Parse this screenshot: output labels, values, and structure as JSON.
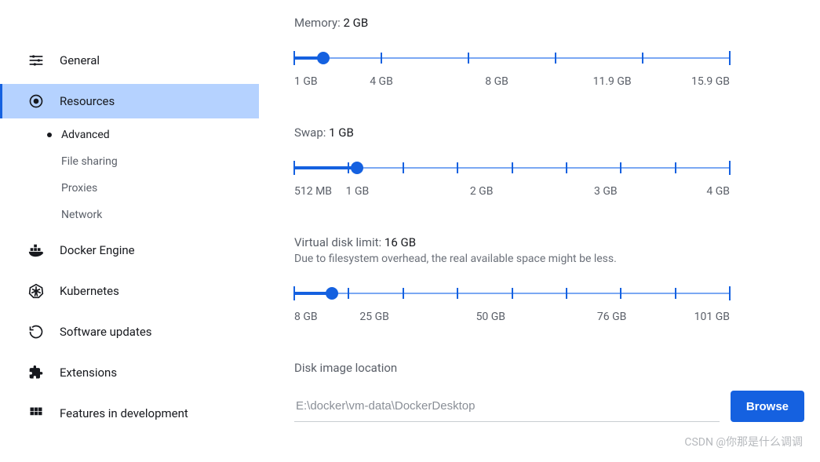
{
  "sidebar": {
    "items": [
      {
        "label": "General"
      },
      {
        "label": "Resources"
      },
      {
        "label": "Docker Engine"
      },
      {
        "label": "Kubernetes"
      },
      {
        "label": "Software updates"
      },
      {
        "label": "Extensions"
      },
      {
        "label": "Features in development"
      }
    ],
    "resources_sub": [
      {
        "label": "Advanced",
        "selected": true
      },
      {
        "label": "File sharing"
      },
      {
        "label": "Proxies"
      },
      {
        "label": "Network"
      }
    ]
  },
  "memory": {
    "label": "Memory:",
    "value": "2 GB",
    "ticks_pct": [
      0,
      20,
      40,
      60,
      80,
      100
    ],
    "thumb_pct": 6.7,
    "scale_labels": [
      "1 GB",
      "4 GB",
      "8 GB",
      "11.9 GB",
      "15.9 GB"
    ],
    "scale_pos_pct": [
      0,
      20,
      46.5,
      73,
      100
    ]
  },
  "swap": {
    "label": "Swap:",
    "value": "1 GB",
    "ticks_pct": [
      0,
      12.5,
      25,
      37.5,
      50,
      62.5,
      75,
      87.5,
      100
    ],
    "thumb_pct": 14.5,
    "scale_labels": [
      "512 MB",
      "1 GB",
      "2 GB",
      "3 GB",
      "4 GB"
    ],
    "scale_pos_pct": [
      0,
      14.5,
      43,
      71.5,
      100
    ]
  },
  "vdisk": {
    "label": "Virtual disk limit:",
    "value": "16 GB",
    "note": "Due to filesystem overhead, the real available space might be less.",
    "ticks_pct": [
      0,
      12.5,
      25,
      37.5,
      50,
      62.5,
      75,
      87.5,
      100
    ],
    "thumb_pct": 8.6,
    "scale_labels": [
      "8 GB",
      "25 GB",
      "50 GB",
      "76 GB",
      "101 GB"
    ],
    "scale_pos_pct": [
      0,
      18.4,
      45.1,
      72.9,
      100
    ]
  },
  "disk_location": {
    "title": "Disk image location",
    "path": "E:\\docker\\vm-data\\DockerDesktop",
    "browse": "Browse"
  },
  "watermark": "CSDN @你那是什么调调"
}
